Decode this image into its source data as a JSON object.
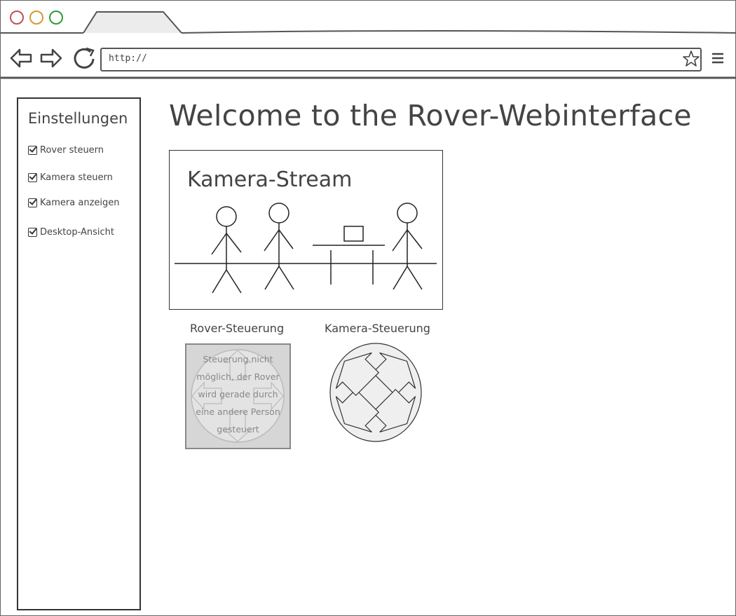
{
  "browser": {
    "url": "http://"
  },
  "sidebar": {
    "title": "Einstellungen",
    "items": [
      {
        "label": "Rover steuern",
        "checked": true
      },
      {
        "label": "Kamera steuern",
        "checked": true
      },
      {
        "label": "Kamera anzeigen",
        "checked": true
      },
      {
        "label": "Desktop-Ansicht",
        "checked": true
      }
    ]
  },
  "main": {
    "title": "Welcome to the Rover-Webinterface",
    "camera": {
      "title": "Kamera-Stream"
    },
    "rover_control": {
      "label": "Rover-Steuerung",
      "message_lines": [
        "Steuerung nicht",
        "möglich, der Rover",
        "wird gerade durch",
        "eine andere Person",
        "gesteuert"
      ]
    },
    "camera_control": {
      "label": "Kamera-Steuerung"
    }
  }
}
